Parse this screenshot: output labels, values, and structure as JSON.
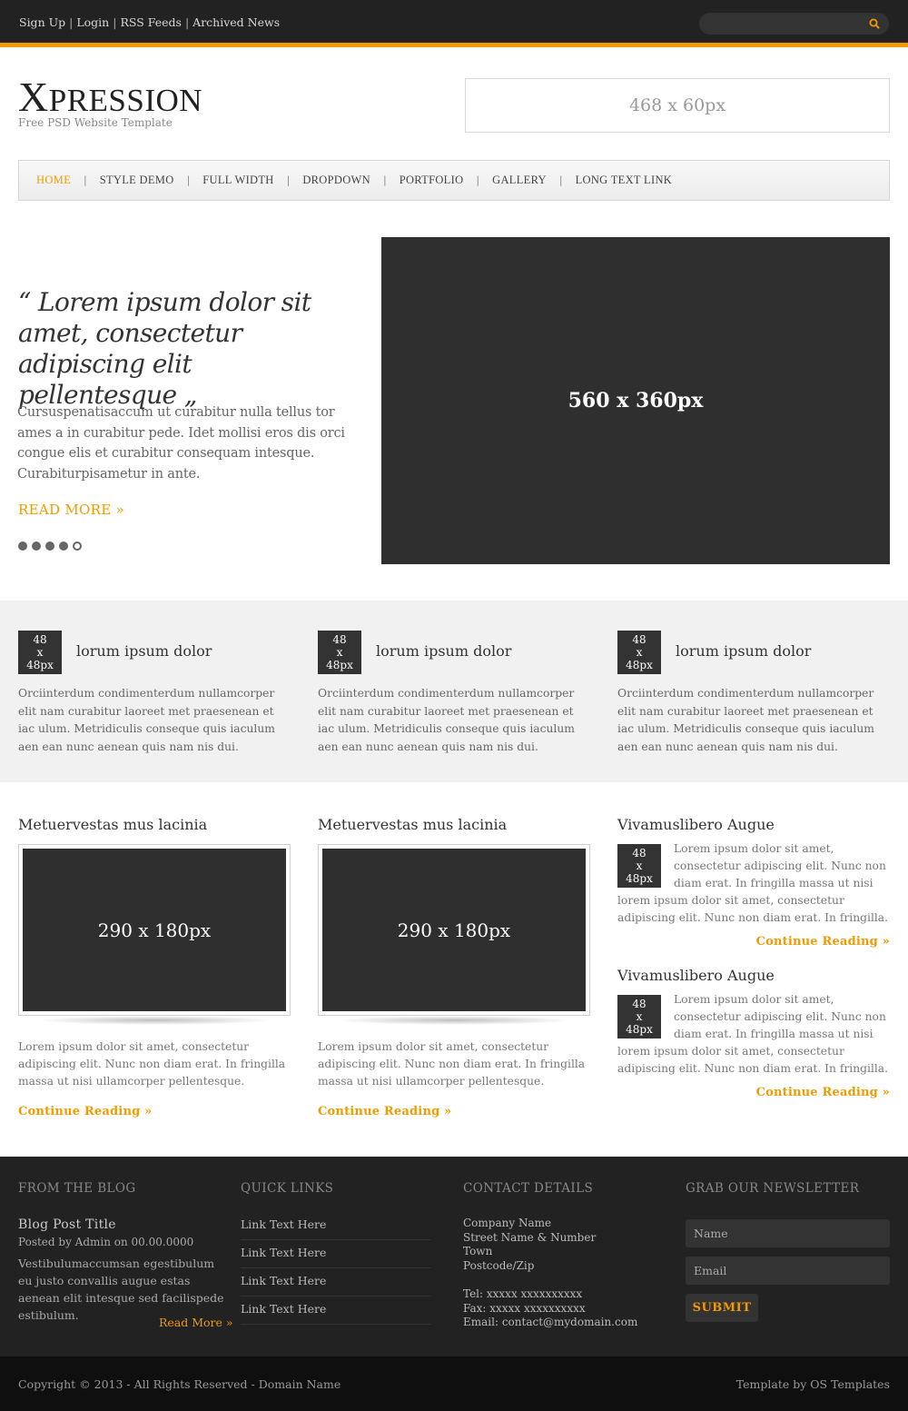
{
  "topbar": {
    "links": [
      "Sign Up",
      "Login",
      "RSS Feeds",
      "Archived News"
    ],
    "separator": "|",
    "search_placeholder": ""
  },
  "header": {
    "logo_initial": "X",
    "logo_rest": "PRESSION",
    "tagline": "Free PSD Website Template",
    "banner": "468 x 60px"
  },
  "nav": {
    "items": [
      "HOME",
      "STYLE DEMO",
      "FULL WIDTH",
      "DROPDOWN",
      "PORTFOLIO",
      "GALLERY",
      "LONG TEXT LINK"
    ],
    "divider": "|",
    "active_index": 0
  },
  "hero": {
    "quote": "“ Lorem ipsum dolor sit amet, consectetur adipiscing elit pellentesque „",
    "text": "Cursuspenatisaccum ut curabitur nulla tellus tor ames a in curabitur pede. Idet mollisi eros dis orci congue elis et curabitur consequam intesque. Curabiturpisametur in ante.",
    "read_more": "READ MORE »",
    "image_label": "560 x 360px",
    "slide_count": 5,
    "active_slide": 5
  },
  "features": [
    {
      "thumb": [
        "48",
        "x",
        "48px"
      ],
      "title": "lorum ipsum dolor",
      "text": "Orciinterdum condimenterdum nullamcorper elit nam curabitur laoreet met praesenean et iac ulum. Metridiculis conseque quis iaculum aen ean nunc aenean quis nam nis dui."
    },
    {
      "thumb": [
        "48",
        "x",
        "48px"
      ],
      "title": "lorum ipsum dolor",
      "text": "Orciinterdum condimenterdum nullamcorper elit nam curabitur laoreet met praesenean et iac ulum. Metridiculis conseque quis iaculum aen ean nunc aenean quis nam nis dui."
    },
    {
      "thumb": [
        "48",
        "x",
        "48px"
      ],
      "title": "lorum ipsum dolor",
      "text": "Orciinterdum condimenterdum nullamcorper elit nam curabitur laoreet met praesenean et iac ulum. Metridiculis conseque quis iaculum aen ean nunc aenean quis nam nis dui."
    }
  ],
  "articles": [
    {
      "title": "Metuervestas mus lacinia",
      "image_label": "290 x 180px",
      "text": "Lorem ipsum dolor sit amet, consectetur adipiscing elit. Nunc non diam erat. In fringilla massa ut nisi ullamcorper pellentesque.",
      "link": "Continue Reading »"
    },
    {
      "title": "Metuervestas mus lacinia",
      "image_label": "290 x 180px",
      "text": "Lorem ipsum dolor sit amet, consectetur adipiscing elit. Nunc non diam erat. In fringilla massa ut nisi ullamcorper pellentesque.",
      "link": "Continue Reading »"
    }
  ],
  "side_posts": [
    {
      "title": "Vivamuslibero Augue",
      "thumb": [
        "48",
        "x",
        "48px"
      ],
      "text": "Lorem ipsum dolor sit amet, consectetur adipiscing elit. Nunc non diam erat. In fringilla massa ut nisi lorem ipsum dolor sit amet, consectetur adipiscing elit. Nunc non diam erat. In fringilla.",
      "link": "Continue Reading »"
    },
    {
      "title": "Vivamuslibero Augue",
      "thumb": [
        "48",
        "x",
        "48px"
      ],
      "text": "Lorem ipsum dolor sit amet, consectetur adipiscing elit. Nunc non diam erat. In fringilla massa ut nisi lorem ipsum dolor sit amet, consectetur adipiscing elit. Nunc non diam erat. In fringilla.",
      "link": "Continue Reading »"
    }
  ],
  "footer": {
    "blog": {
      "heading": "FROM THE BLOG",
      "post_title": "Blog Post Title",
      "meta": "Posted by Admin on 00.00.0000",
      "excerpt": "Vestibulumaccumsan egestibulum eu justo convallis augue estas aenean elit intesque sed facilispede estibulum.",
      "read_more": "Read More »"
    },
    "quick_links": {
      "heading": "QUICK LINKS",
      "links": [
        "Link Text Here",
        "Link Text Here",
        "Link Text Here",
        "Link Text Here"
      ]
    },
    "contact": {
      "heading": "CONTACT DETAILS",
      "lines": [
        "Company Name",
        "Street Name & Number",
        "Town",
        "Postcode/Zip",
        "",
        "Tel: xxxxx xxxxxxxxxx",
        "Fax: xxxxx xxxxxxxxxx",
        "Email: contact@mydomain.com"
      ]
    },
    "newsletter": {
      "heading": "GRAB OUR NEWSLETTER",
      "name_placeholder": "Name",
      "email_placeholder": "Email",
      "submit": "SUBMIT"
    }
  },
  "bottombar": {
    "copyright": "Copyright © 2013 - All Rights Reserved - Domain Name",
    "credit": "Template by OS Templates"
  },
  "colors": {
    "accent": "#f29b00",
    "dark": "#222222",
    "placeholder_block": "#2f2f2f"
  }
}
